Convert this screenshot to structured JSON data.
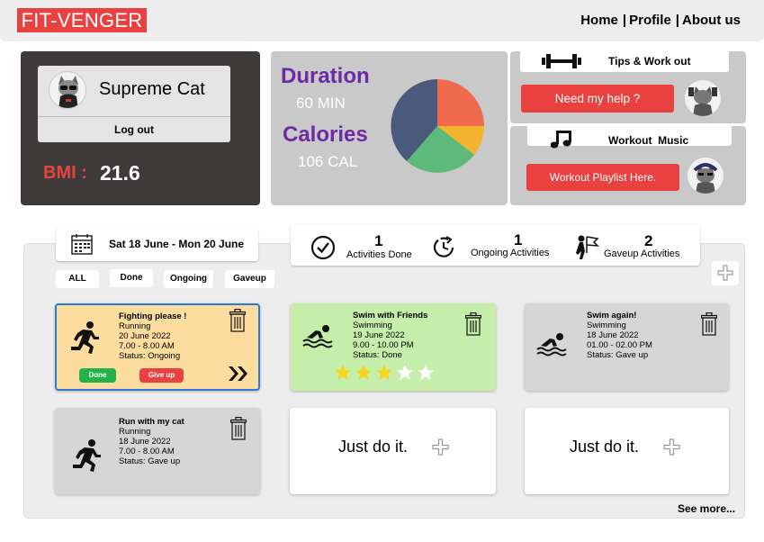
{
  "header": {
    "logo": "FIT-VENGER",
    "nav": [
      {
        "label": "Home"
      },
      {
        "label": "Profile"
      },
      {
        "label": "About us"
      }
    ],
    "separator": "|"
  },
  "profile": {
    "username": "Supreme Cat",
    "logout_label": "Log out",
    "bmi_label": "BMI :",
    "bmi_value": "21.6"
  },
  "summary": {
    "duration_label": "Duration",
    "duration_value": "60 MIN",
    "calories_label": "Calories",
    "calories_value": "106 CAL",
    "pie_colors": [
      "#f06a4d",
      "#f3b530",
      "#5dba7a",
      "#4a5a7c"
    ]
  },
  "tips": {
    "title": "Tips & Work out",
    "button": "Need my help ?"
  },
  "music": {
    "title": "Workout  Music",
    "button": "Workout Playlist Here."
  },
  "activities": {
    "date_range": "Sat 18 June - Mon 20 June",
    "stats": [
      {
        "count": "1",
        "label": "Activities Done"
      },
      {
        "count": "1",
        "label": "Ongoing Activities"
      },
      {
        "count": "2",
        "label": "Gaveup Activities"
      }
    ],
    "filters": [
      "ALL",
      "Done",
      "Ongoing",
      "Gaveup"
    ],
    "cards": [
      {
        "title": "Fighting please !",
        "sport": "Running",
        "date": "20 June 2022",
        "time": "7.00 - 8.00 AM",
        "status": "Status: Ongoing",
        "done_label": "Done",
        "giveup_label": "Give up"
      },
      {
        "title": "Swim with Friends",
        "sport": "Swimming",
        "date": "19 June 2022",
        "time": "9.00 - 10.00 PM",
        "status": "Status: Done",
        "rating": 3,
        "rating_max": 5
      },
      {
        "title": "Swim again!",
        "sport": "Swimming",
        "date": "18 June 2022",
        "time": "01.00 - 02.00 PM",
        "status": "Status: Gave up"
      },
      {
        "title": "Run with my cat",
        "sport": "Running",
        "date": "18 June 2022",
        "time": "7.00 - 8.00 AM",
        "status": "Status: Gave up"
      }
    ],
    "placeholder_text": "Just do it.",
    "see_more": "See more..."
  },
  "colors": {
    "brand_red": "#e8413f",
    "purple": "#6c2aa4",
    "ongoing_card": "#fddd9f",
    "done_card": "#c6eeab",
    "gaveup_card": "#d6d6d6",
    "selected_border": "#2a7ad6"
  }
}
